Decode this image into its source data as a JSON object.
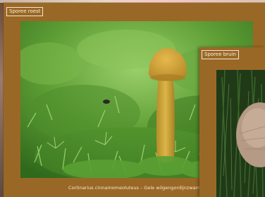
{
  "cards": [
    {
      "label": "Sporee roest",
      "caption": "Cortinarius cinnamomeoluteus – Gele wilgengordijnzwam"
    },
    {
      "label": "Sporee bruin"
    }
  ]
}
